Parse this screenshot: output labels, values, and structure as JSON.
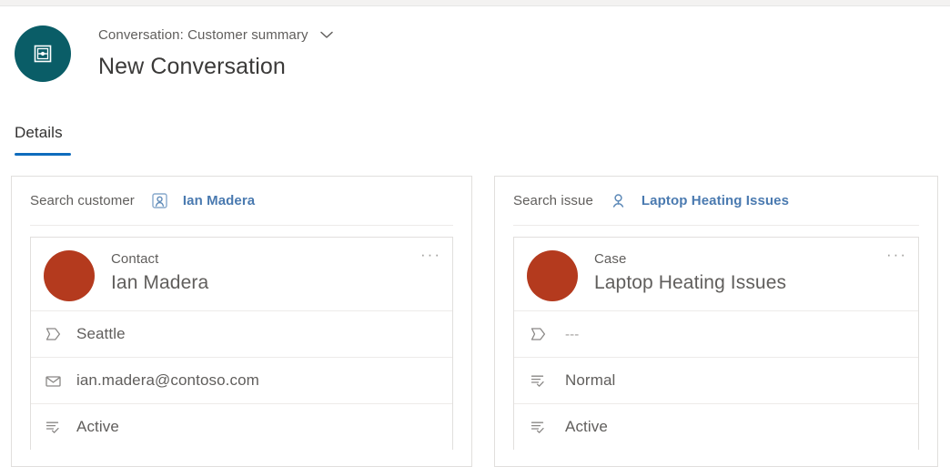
{
  "colors": {
    "header_avatar_bg": "#0a5d67",
    "record_avatar_bg": "#b43a1e",
    "link_blue": "#4a7ab0",
    "tab_accent": "#0f6cbd",
    "text_primary": "#3b3a39",
    "text_secondary": "#605e5c",
    "border": "#e1dfdd"
  },
  "header": {
    "icon": "conversation-icon",
    "subtitle": "Conversation: Customer summary",
    "chevron": "chevron-down-icon",
    "title": "New Conversation"
  },
  "tabs": [
    {
      "label": "Details",
      "selected": true
    }
  ],
  "panels": [
    {
      "id": "customer",
      "search_label": "Search customer",
      "search_icon": "contact-card-icon",
      "search_value": "Ian Madera",
      "record": {
        "avatar": "record-avatar",
        "type": "Contact",
        "name": "Ian Madera",
        "more": "···",
        "fields": [
          {
            "icon": "tag-icon",
            "value": "Seattle",
            "muted": false
          },
          {
            "icon": "email-icon",
            "value": "ian.madera@contoso.com",
            "muted": false
          },
          {
            "icon": "status-icon",
            "value": "Active",
            "muted": false
          }
        ]
      }
    },
    {
      "id": "issue",
      "search_label": "Search issue",
      "search_icon": "case-person-icon",
      "search_value": "Laptop Heating Issues",
      "record": {
        "avatar": "record-avatar",
        "type": "Case",
        "name": "Laptop Heating Issues",
        "more": "···",
        "fields": [
          {
            "icon": "tag-icon",
            "value": "---",
            "muted": true
          },
          {
            "icon": "status-icon",
            "value": "Normal",
            "muted": false
          },
          {
            "icon": "status-icon",
            "value": "Active",
            "muted": false
          }
        ]
      }
    }
  ]
}
